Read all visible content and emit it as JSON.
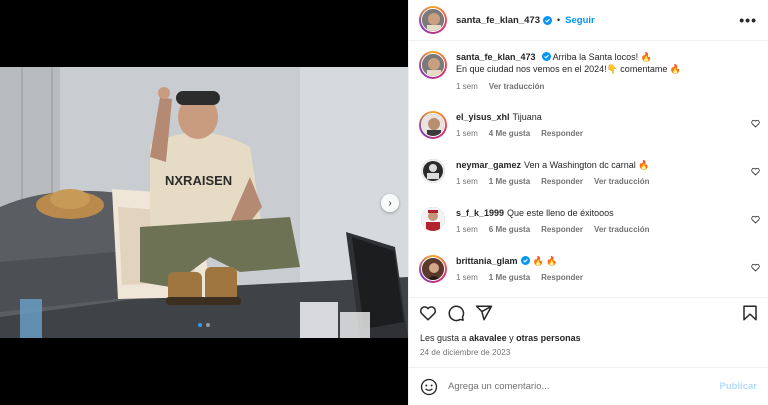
{
  "post": {
    "author": "santa_fe_klan_473",
    "follow_label": "Seguir",
    "more_label": "•••",
    "dot_separator": "•"
  },
  "caption": {
    "username": "santa_fe_klan_473",
    "line1": "Arriba la Santa locos! 🔥",
    "line2": "En que ciudad nos vemos en el 2024!👇 comentame 🔥",
    "time": "1 sem",
    "translate": "Ver traducción"
  },
  "comments": [
    {
      "username": "el_yisus_xhl",
      "text": "Tijuana",
      "time": "1 sem",
      "likes": "4 Me gusta",
      "reply": "Responder",
      "translate": ""
    },
    {
      "username": "neymar_gamez",
      "text": "Ven a Washington dc carnal 🔥",
      "time": "1 sem",
      "likes": "1 Me gusta",
      "reply": "Responder",
      "translate": "Ver traducción"
    },
    {
      "username": "s_f_k_1999",
      "text": "Que este lleno de éxitooos",
      "time": "1 sem",
      "likes": "6 Me gusta",
      "reply": "Responder",
      "translate": "Ver traducción"
    },
    {
      "username": "brittania_glam",
      "text": "🔥 🔥",
      "time": "1 sem",
      "likes": "1 Me gusta",
      "reply": "Responder",
      "translate": ""
    }
  ],
  "likes": {
    "prefix": "Les gusta a",
    "user": "akavalee",
    "joiner": "y",
    "others": "otras personas"
  },
  "date": "24 de diciembre de 2023",
  "composer": {
    "placeholder": "Agrega un comentario...",
    "publish_label": "Publicar"
  },
  "carousel": {
    "next_label": "›",
    "slide_count": 2,
    "active_index": 0
  },
  "colors": {
    "link_blue": "#0095f6",
    "publish_disabled": "#b3dbff",
    "verified_blue": "#0095f6",
    "muted_text": "#737373"
  },
  "icons": [
    "verified-badge-icon",
    "more-options-icon",
    "heart-icon",
    "comment-icon",
    "share-icon",
    "bookmark-icon",
    "emoji-icon",
    "chevron-right-icon"
  ]
}
